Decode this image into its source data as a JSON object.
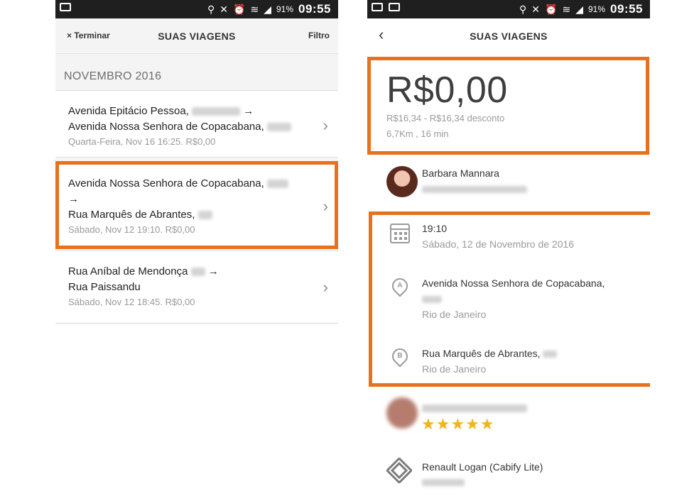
{
  "status_bar": {
    "battery": "91%",
    "time": "09:55"
  },
  "list_screen": {
    "close_label": "× Terminar",
    "title": "SUAS VIAGENS",
    "filter_label": "Filtro",
    "month": "NOVEMBRO 2016",
    "trips": [
      {
        "line1": "Avenida Epitácio Pessoa,",
        "arrow1": "→",
        "line2": "Avenida Nossa Senhora de Copacabana,",
        "meta": "Quarta-Feira, Nov 16 16:25. R$0,00"
      },
      {
        "line1": "Avenida Nossa Senhora de Copacabana,",
        "arrow_line": "→",
        "line2": "Rua Marquês de Abrantes,",
        "meta": "Sábado, Nov 12 19:10. R$0,00"
      },
      {
        "line1": "Rua Aníbal de Mendonça",
        "arrow1": "→",
        "line2": "Rua Paissandu",
        "meta": "Sábado, Nov 12 18:45. R$0,00"
      }
    ]
  },
  "detail_screen": {
    "back_icon": "‹",
    "title": "SUAS VIAGENS",
    "price": "R$0,00",
    "price_range": "R$16,34 - R$16,34 desconto",
    "distance_time": "6,7Km , 16 min",
    "passenger_name": "Barbara Mannara",
    "time": "19:10",
    "date": "Sábado, 12 de Novembro de 2016",
    "origin_street": "Avenida Nossa Senhora de Copacabana,",
    "origin_city": "Rio de Janeiro",
    "origin_marker": "A",
    "destination_street": "Rua Marquês de Abrantes,",
    "destination_city": "Rio de Janeiro",
    "destination_marker": "B",
    "rating": "★★★★★",
    "car": "Renault Logan (Cabify Lite)"
  },
  "colors": {
    "highlight": "#e8711e",
    "stars": "#f2b418",
    "status_bar": "#1f1f1f"
  }
}
